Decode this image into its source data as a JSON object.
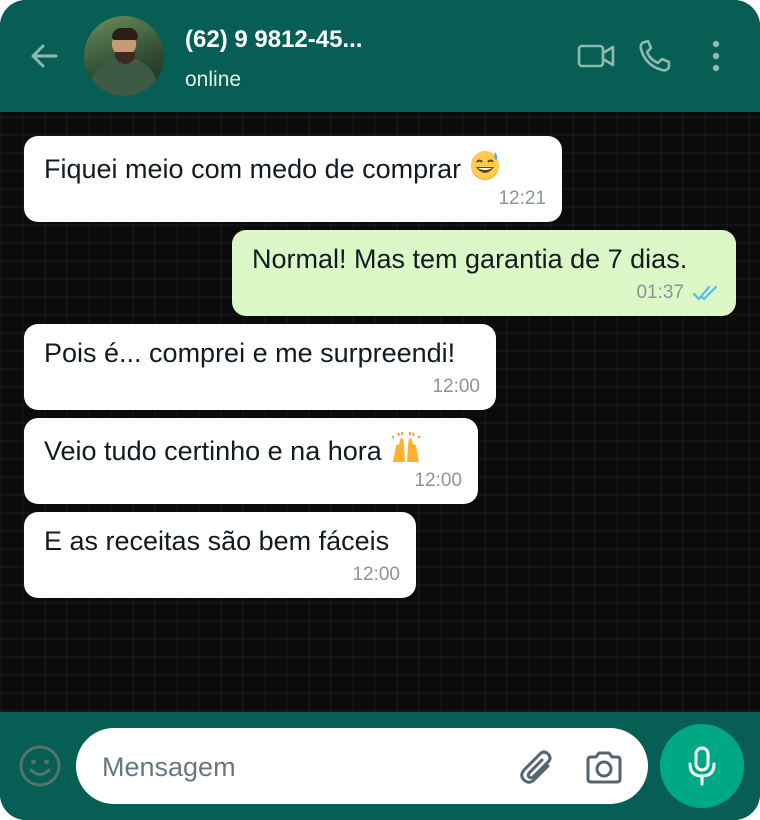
{
  "header": {
    "contact_name": "(62) 9 9812-45...",
    "status": "online",
    "icons": [
      "back-arrow-icon",
      "video-call-icon",
      "voice-call-icon",
      "more-options-icon"
    ]
  },
  "messages": [
    {
      "direction": "incoming",
      "text": "Fiquei meio com medo de comprar",
      "emoji": "grinning-sweat",
      "time": "12:21"
    },
    {
      "direction": "outgoing",
      "text": "Normal! Mas tem garantia de 7 dias.",
      "time": "01:37",
      "read": true
    },
    {
      "direction": "incoming",
      "text": "Pois é... comprei e me surpreendi!",
      "time": "12:00"
    },
    {
      "direction": "incoming",
      "text": "Veio tudo certinho e na hora",
      "emoji": "raising-hands",
      "time": "12:00"
    },
    {
      "direction": "incoming",
      "text": "E as receitas são bem fáceis",
      "time": "12:00"
    }
  ],
  "composer": {
    "placeholder": "Mensagem",
    "value": ""
  },
  "colors": {
    "header": "#075e54",
    "outgoing_bubble": "#dcf8c6",
    "incoming_bubble": "#ffffff",
    "mic_button": "#00a884",
    "read_ticks": "#53bdeb"
  }
}
